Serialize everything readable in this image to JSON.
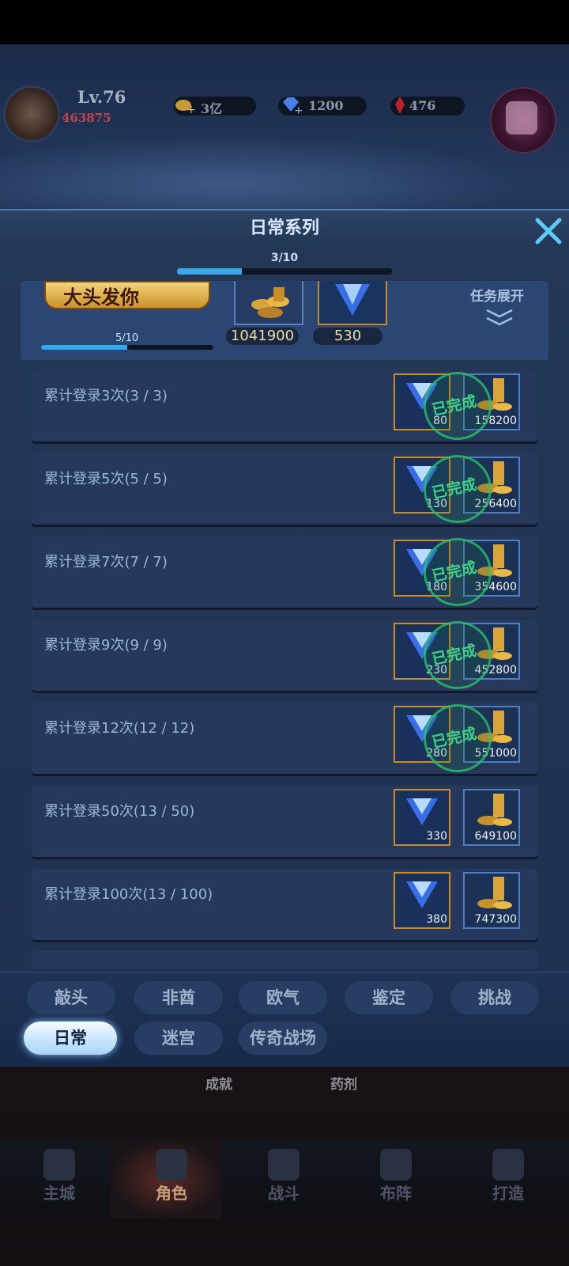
{
  "hud": {
    "level": "Lv.76",
    "power": "463875",
    "gold": "3亿",
    "diamond": "1200",
    "ruby": "476"
  },
  "panel": {
    "title": "日常系列",
    "progress_label": "3/10",
    "progress_fraction": 0.3
  },
  "series_card": {
    "banner": "大头发你",
    "progress_label": "5/10",
    "progress_fraction": 0.5,
    "reward_gold": "1041900",
    "reward_gem": "530",
    "expand_label": "任务展开"
  },
  "tasks": [
    {
      "text": "累计登录3次(3 / 3)",
      "gem": "80",
      "gold": "158200",
      "done": true
    },
    {
      "text": "累计登录5次(5 / 5)",
      "gem": "130",
      "gold": "256400",
      "done": true
    },
    {
      "text": "累计登录7次(7 / 7)",
      "gem": "180",
      "gold": "354600",
      "done": true
    },
    {
      "text": "累计登录9次(9 / 9)",
      "gem": "230",
      "gold": "452800",
      "done": true
    },
    {
      "text": "累计登录12次(12 / 12)",
      "gem": "280",
      "gold": "551000",
      "done": true
    },
    {
      "text": "累计登录50次(13 / 50)",
      "gem": "330",
      "gold": "649100",
      "done": false
    },
    {
      "text": "累计登录100次(13 / 100)",
      "gem": "380",
      "gold": "747300",
      "done": false
    }
  ],
  "stamp_text": "已完成",
  "tabs_row1": [
    "敲头",
    "非酋",
    "欧气",
    "鉴定",
    "挑战"
  ],
  "tabs_row2": [
    "日常",
    "迷宫",
    "传奇战场"
  ],
  "active_tab": "日常",
  "under_panel": {
    "achievement": "成就",
    "potion": "药剂"
  },
  "nav": [
    "主城",
    "角色",
    "战斗",
    "布阵",
    "打造"
  ],
  "colors": {
    "accent": "#3ba7e8",
    "gem_border": "#c98c2b",
    "stamp": "#3fd38a"
  }
}
